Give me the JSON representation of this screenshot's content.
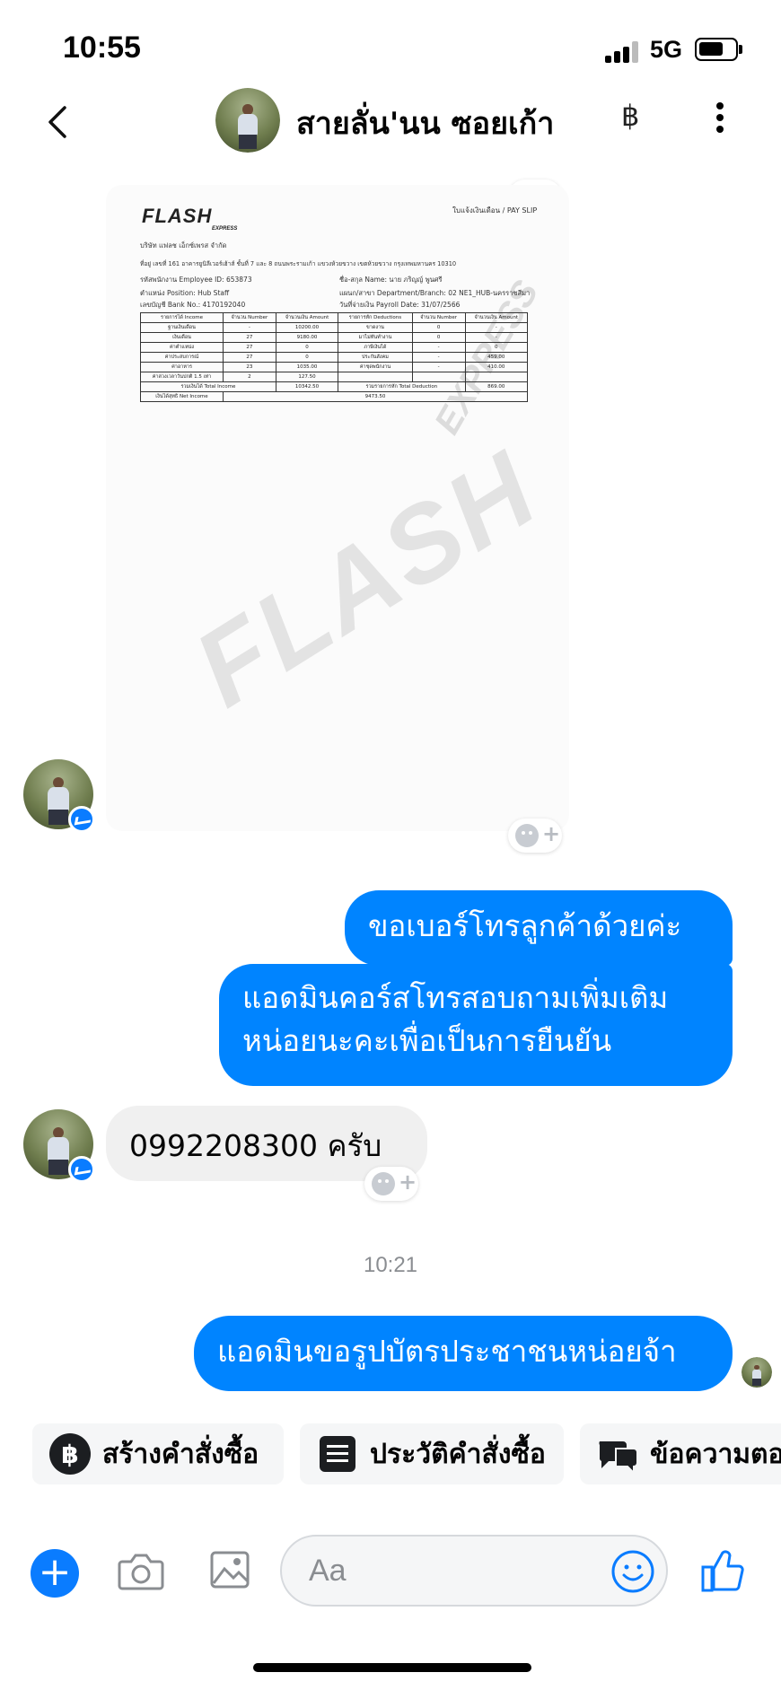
{
  "status_bar": {
    "time": "10:55",
    "network": "5G"
  },
  "header": {
    "contact_name": "สายลั่น'นน ซอยเก้า",
    "baht_symbol": "฿"
  },
  "payslip": {
    "logo": "FLASH",
    "logo_sub": "EXPRESS",
    "title": "ใบแจ้งเงินเดือน / PAY SLIP",
    "company": "บริษัท แฟลช เอ็กซ์เพรส จำกัด",
    "address": "ที่อยู่ เลขที่ 161 อาคารยูนิลีเวอร์เฮ้าส์ ชั้นที่ 7 และ 8 ถนนพระรามเก้า แขวงห้วยขวาง เขตห้วยขวาง กรุงเทพมหานคร 10310",
    "employee_id": "รหัสพนักงาน Employee ID: 653873",
    "name": "ชื่อ-สกุล Name: นาย ภริญญ์ พูนศรี",
    "position": "ตำแหน่ง Position: Hub Staff",
    "branch": "แผนก/สาขา Department/Branch: 02 NE1_HUB-นครราชสีมา",
    "bank": "เลขบัญชี Bank No.: 4170192040",
    "payroll_date": "วันที่จ่ายเงิน Payroll Date: 31/07/2566",
    "table_header": [
      "รายการได้ Income",
      "จำนวน Number",
      "จำนวนเงิน Amount",
      "รายการหัก Deductions",
      "จำนวน Number",
      "จำนวนเงิน Amount"
    ],
    "table_rows": [
      [
        "ฐานเงินเดือน",
        "-",
        "10200.00",
        "ขาดงาน",
        "0",
        "-"
      ],
      [
        "เงินเดือน",
        "27",
        "9180.00",
        "มาไม่ทันทำงาน",
        "0",
        "-"
      ],
      [
        "ค่าตำแหน่ง",
        "27",
        "0",
        "ภาษีเงินได้",
        "-",
        "0"
      ],
      [
        "ค่าประสบการณ์",
        "27",
        "0",
        "ประกันสังคม",
        "-",
        "459.00"
      ],
      [
        "ค่าอาหาร",
        "23",
        "1035.00",
        "ค่าชุดพนักงาน",
        "-",
        "410.00"
      ],
      [
        "ค่าล่วงเวลาวันปกติ 1.5 เท่า",
        "2",
        "127.50",
        "",
        "",
        ""
      ]
    ],
    "total_income_label": "รวมเงินได้ Total Income",
    "total_income": "10342.50",
    "total_deduction_label": "รวมรายการหัก Total Deduction",
    "total_deduction": "869.00",
    "net_label": "เงินได้สุทธิ Net Income",
    "net_income": "9473.50",
    "watermark": "FLASH",
    "watermark_sub": "EXPRESS"
  },
  "messages": {
    "out_1": "ขอเบอร์โทรลูกค้าด้วยค่ะ",
    "out_2_line1": "แอดมินคอร์สโทรสอบถามเพิ่มเติม",
    "out_2_line2": "หน่อยนะคะเพื่อเป็นการยืนยัน",
    "in_1": "0992208300 ครับ",
    "timestamp": "10:21",
    "out_3": "แอดมินขอรูปบัตรประชาชนหน่อยจ้า"
  },
  "quick_actions": [
    "สร้างคำสั่งซื้อ",
    "ประวัติคำสั่งซื้อ",
    "ข้อความตอ"
  ],
  "composer": {
    "placeholder": "Aa"
  },
  "colors": {
    "accent": "#0084ff",
    "bubble_in": "#f0f0f0",
    "badge": "#0a7cff"
  },
  "icons": [
    "back-icon",
    "baht-icon",
    "more-icon",
    "reaction-icon",
    "messenger-badge-icon",
    "plus-icon",
    "camera-icon",
    "gallery-icon",
    "emoji-icon",
    "like-icon",
    "order-list-icon",
    "chat-icon"
  ]
}
